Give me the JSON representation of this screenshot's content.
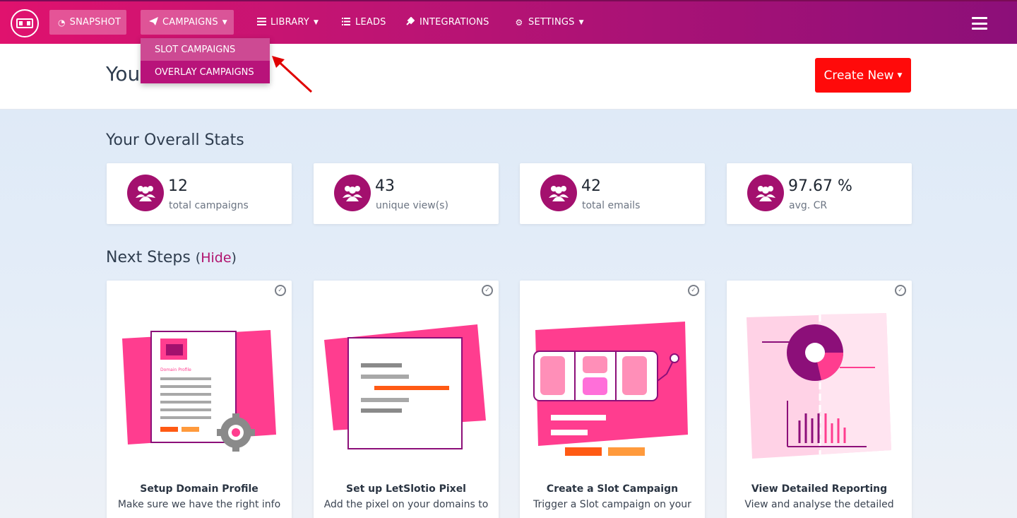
{
  "nav": {
    "snapshot": "SNAPSHOT",
    "campaigns": "CAMPAIGNS",
    "library": "LIBRARY",
    "leads": "LEADS",
    "integrations": "INTEGRATIONS",
    "settings": "SETTINGS"
  },
  "dropdown": {
    "items": [
      {
        "label": "SLOT CAMPAIGNS"
      },
      {
        "label": "OVERLAY CAMPAIGNS"
      }
    ]
  },
  "header": {
    "title_partial": "You",
    "create_button": "Create New"
  },
  "stats": {
    "title": "Your Overall Stats",
    "cards": [
      {
        "value": "12",
        "label": "total campaigns"
      },
      {
        "value": "43",
        "label": "unique view(s)"
      },
      {
        "value": "42",
        "label": "total emails"
      },
      {
        "value": "97.67 %",
        "label": "avg. CR"
      }
    ]
  },
  "next_steps": {
    "title": "Next Steps",
    "hide_open": "(",
    "hide_link": "Hide",
    "hide_close": ")",
    "cards": [
      {
        "title": "Setup Domain Profile",
        "desc": "Make sure we have the right info",
        "illu_text": "Domain Profile"
      },
      {
        "title": "Set up LetSlotio Pixel",
        "desc": "Add the pixel on your domains to"
      },
      {
        "title": "Create a Slot Campaign",
        "desc": "Trigger a Slot campaign on your"
      },
      {
        "title": "View Detailed Reporting",
        "desc": "View and analyse the detailed"
      }
    ]
  },
  "colors": {
    "brand": "#b8137a",
    "accent_pink": "#ff3d8f",
    "create_red": "#ff0a0a",
    "dark_purple": "#8c0f79"
  }
}
